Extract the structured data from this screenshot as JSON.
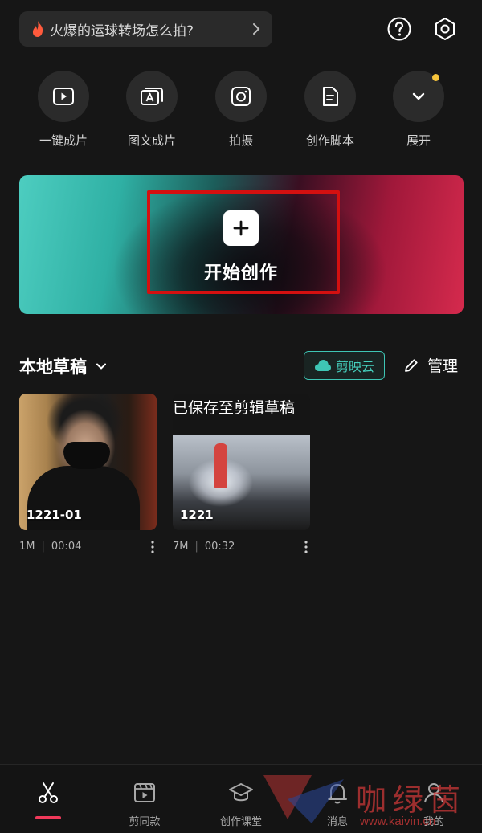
{
  "search": {
    "text": "火爆的运球转场怎么拍?"
  },
  "quick_actions": [
    {
      "label": "一键成片",
      "icon": "play-box-icon"
    },
    {
      "label": "图文成片",
      "icon": "text-image-icon"
    },
    {
      "label": "拍摄",
      "icon": "camera-icon"
    },
    {
      "label": "创作脚本",
      "icon": "script-icon"
    },
    {
      "label": "展开",
      "icon": "chevron-down-icon",
      "badge_color": "#f5c33b"
    }
  ],
  "hero": {
    "label": "开始创作"
  },
  "drafts": {
    "title": "本地草稿",
    "cloud_label": "剪映云",
    "manage_label": "管理",
    "saved_overlay": "已保存至剪辑草稿",
    "items": [
      {
        "title": "1221-01",
        "size": "1M",
        "duration": "00:04"
      },
      {
        "title": "1221",
        "size": "7M",
        "duration": "00:32"
      }
    ]
  },
  "bottom_nav": {
    "items": [
      {
        "label": "",
        "icon": "scissors-icon",
        "active": true
      },
      {
        "label": "剪同款",
        "icon": "clapperboard-icon"
      },
      {
        "label": "创作课堂",
        "icon": "graduation-cap-icon"
      },
      {
        "label": "消息",
        "icon": "bell-icon"
      },
      {
        "label": "我的",
        "icon": "user-icon"
      }
    ]
  },
  "watermark": {
    "cn": "咖绿茵",
    "url": "www.kaivin.cn"
  },
  "colors": {
    "accent": "#3ec6b5",
    "active": "#f0395a",
    "highlight_frame": "#d41010",
    "badge": "#f5c33b"
  }
}
